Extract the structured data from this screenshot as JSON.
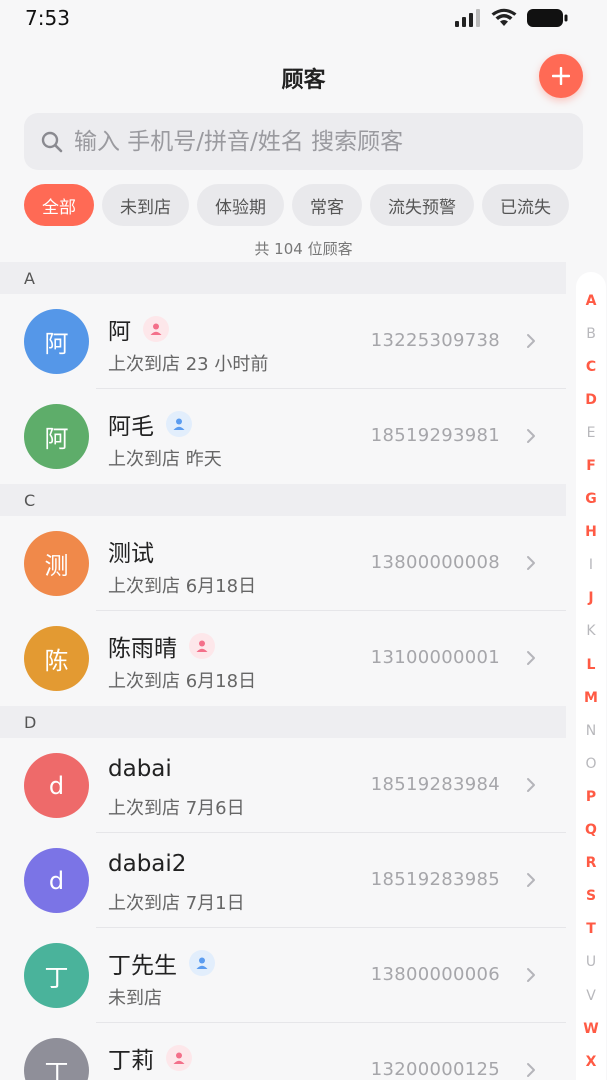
{
  "status_bar": {
    "time": "7:53"
  },
  "header": {
    "title": "顾客"
  },
  "search": {
    "placeholder": "输入 手机号/拼音/姓名 搜索顾客"
  },
  "filters": [
    {
      "label": "全部",
      "active": true
    },
    {
      "label": "未到店",
      "active": false
    },
    {
      "label": "体验期",
      "active": false
    },
    {
      "label": "常客",
      "active": false
    },
    {
      "label": "流失预警",
      "active": false
    },
    {
      "label": "已流失",
      "active": false
    }
  ],
  "summary": {
    "total_text": "共 104 位顾客"
  },
  "colors": {
    "accent": "#ff6a55",
    "female": "#f3708a",
    "male": "#5b9cf0"
  },
  "sections": [
    {
      "letter": "A",
      "customers": [
        {
          "avatar": "阿",
          "name": "阿",
          "gender": "female",
          "last_visit": "上次到店 23 小时前",
          "phone": "13225309738",
          "color": "#5597e8"
        },
        {
          "avatar": "阿",
          "name": "阿毛",
          "gender": "male",
          "last_visit": "上次到店 昨天",
          "phone": "18519293981",
          "color": "#5ead6a"
        }
      ]
    },
    {
      "letter": "C",
      "customers": [
        {
          "avatar": "测",
          "name": "测试",
          "gender": "",
          "last_visit": "上次到店 6月18日",
          "phone": "13800000008",
          "color": "#f0894a"
        },
        {
          "avatar": "陈",
          "name": "陈雨晴",
          "gender": "female",
          "last_visit": "上次到店 6月18日",
          "phone": "13100000001",
          "color": "#e39a32"
        }
      ]
    },
    {
      "letter": "D",
      "customers": [
        {
          "avatar": "d",
          "name": "dabai",
          "gender": "",
          "last_visit": "上次到店 7月6日",
          "phone": "18519283984",
          "color": "#ee6a6a"
        },
        {
          "avatar": "d",
          "name": "dabai2",
          "gender": "",
          "last_visit": "上次到店 7月1日",
          "phone": "18519283985",
          "color": "#7b74e6"
        },
        {
          "avatar": "丁",
          "name": "丁先生",
          "gender": "male",
          "last_visit": "未到店",
          "phone": "13800000006",
          "color": "#4ab39b"
        },
        {
          "avatar": "丁",
          "name": "丁莉",
          "gender": "female",
          "last_visit": "",
          "phone": "13200000125",
          "color": "#8f8f99"
        }
      ]
    }
  ],
  "index_letters": [
    {
      "l": "A",
      "on": true
    },
    {
      "l": "B",
      "on": false
    },
    {
      "l": "C",
      "on": true
    },
    {
      "l": "D",
      "on": true
    },
    {
      "l": "E",
      "on": false
    },
    {
      "l": "F",
      "on": true
    },
    {
      "l": "G",
      "on": true
    },
    {
      "l": "H",
      "on": true
    },
    {
      "l": "I",
      "on": false
    },
    {
      "l": "J",
      "on": true
    },
    {
      "l": "K",
      "on": false
    },
    {
      "l": "L",
      "on": true
    },
    {
      "l": "M",
      "on": true
    },
    {
      "l": "N",
      "on": false
    },
    {
      "l": "O",
      "on": false
    },
    {
      "l": "P",
      "on": true
    },
    {
      "l": "Q",
      "on": true
    },
    {
      "l": "R",
      "on": true
    },
    {
      "l": "S",
      "on": true
    },
    {
      "l": "T",
      "on": true
    },
    {
      "l": "U",
      "on": false
    },
    {
      "l": "V",
      "on": false
    },
    {
      "l": "W",
      "on": true
    },
    {
      "l": "X",
      "on": true
    }
  ]
}
